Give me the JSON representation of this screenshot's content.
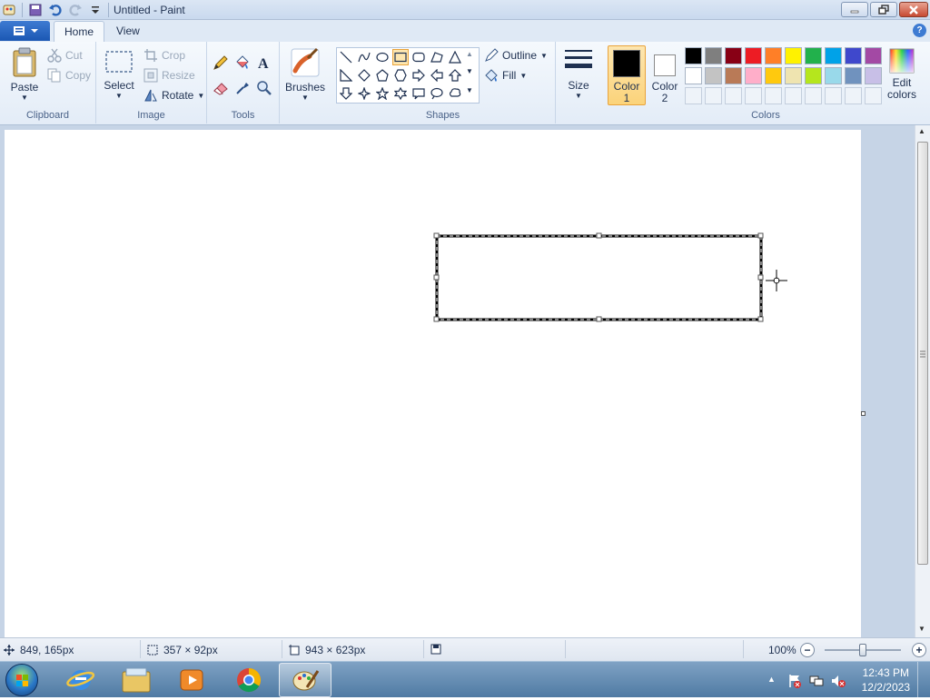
{
  "window": {
    "title": "Untitled - Paint"
  },
  "tabs": [
    {
      "label": "Home"
    },
    {
      "label": "View"
    }
  ],
  "clipboard": {
    "paste": "Paste",
    "cut": "Cut",
    "copy": "Copy",
    "group": "Clipboard"
  },
  "image": {
    "select": "Select",
    "crop": "Crop",
    "resize": "Resize",
    "rotate": "Rotate",
    "group": "Image"
  },
  "tools": {
    "group": "Tools"
  },
  "brushes": {
    "label": "Brushes"
  },
  "shapes": {
    "outline": "Outline",
    "fill": "Fill",
    "group": "Shapes",
    "selected": "rectangle"
  },
  "size": {
    "label": "Size"
  },
  "colors": {
    "color1_label": "Color",
    "color1_num": "1",
    "color2_label": "Color",
    "color2_num": "2",
    "edit_label1": "Edit",
    "edit_label2": "colors",
    "group": "Colors",
    "color1": "#000000",
    "color2": "#ffffff",
    "palette_row1": [
      "#000000",
      "#7f7f7f",
      "#880015",
      "#ed1c24",
      "#ff7f27",
      "#fff200",
      "#22b14c",
      "#00a2e8",
      "#3f48cc",
      "#a349a4"
    ],
    "palette_row2": [
      "#ffffff",
      "#c3c3c3",
      "#b97a57",
      "#ffaec9",
      "#ffc90e",
      "#efe4b0",
      "#b5e61d",
      "#99d9ea",
      "#7092be",
      "#c8bfe7"
    ]
  },
  "status": {
    "cursor_pos": "849, 165px",
    "selection_size": "357 × 92px",
    "canvas_size": "943 × 623px",
    "zoom": "100%"
  },
  "taskbar": {
    "time": "12:43 PM",
    "date": "12/2/2023"
  }
}
